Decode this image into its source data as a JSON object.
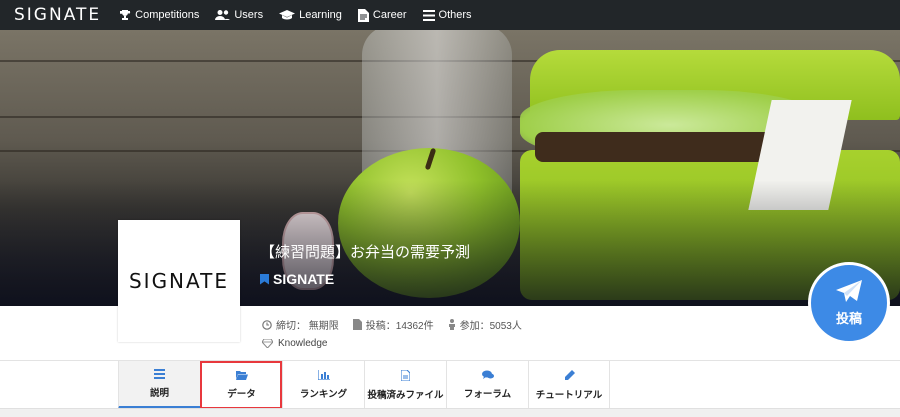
{
  "nav": {
    "logo": "SIGNATE",
    "items": [
      {
        "label": "Competitions",
        "icon": "trophy-icon"
      },
      {
        "label": "Users",
        "icon": "users-icon"
      },
      {
        "label": "Learning",
        "icon": "graduation-cap-icon"
      },
      {
        "label": "Career",
        "icon": "document-icon"
      },
      {
        "label": "Others",
        "icon": "menu-icon"
      }
    ]
  },
  "competition": {
    "thumbnail_logo": "SIGNATE",
    "title": "【練習問題】お弁当の需要予測",
    "organizer": "SIGNATE",
    "deadline": "締切： 無期限",
    "submissions": "投稿：14362件",
    "participants": "参加：5053人",
    "tag": "Knowledge"
  },
  "post_button": {
    "label": "投稿"
  },
  "tabs": [
    {
      "label": "説明",
      "icon": "list-icon",
      "active": true
    },
    {
      "label": "データ",
      "icon": "folder-open-icon",
      "highlighted": true
    },
    {
      "label": "ランキング",
      "icon": "bar-chart-icon"
    },
    {
      "label": "投稿済みファイル",
      "icon": "file-icon"
    },
    {
      "label": "フォーラム",
      "icon": "comments-icon"
    },
    {
      "label": "チュートリアル",
      "icon": "pencil-icon"
    }
  ],
  "colors": {
    "nav_bg": "#222629",
    "accent": "#3b7fd4",
    "post_button": "#3d8ae6",
    "highlight": "#e8383d"
  }
}
